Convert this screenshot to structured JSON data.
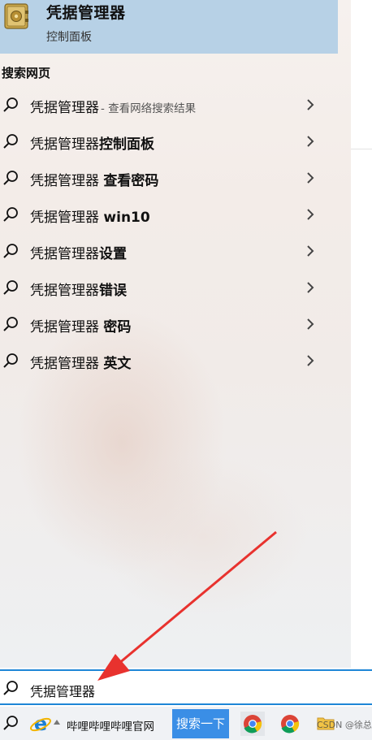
{
  "best_match": {
    "title": "凭据管理器",
    "subtitle": "控制面板",
    "icon": "credential-manager-safe-icon"
  },
  "section_heading": "搜索网页",
  "suggestions": [
    {
      "prefix": "凭据管理器",
      "suffix": "",
      "hint": "- 查看网络搜索结果"
    },
    {
      "prefix": "凭据管理器",
      "suffix": "控制面板",
      "hint": ""
    },
    {
      "prefix": "凭据管理器 ",
      "suffix": "查看密码",
      "hint": ""
    },
    {
      "prefix": "凭据管理器 ",
      "suffix": "win10",
      "hint": ""
    },
    {
      "prefix": "凭据管理器",
      "suffix": "设置",
      "hint": ""
    },
    {
      "prefix": "凭据管理器",
      "suffix": "错误",
      "hint": ""
    },
    {
      "prefix": "凭据管理器 ",
      "suffix": "密码",
      "hint": ""
    },
    {
      "prefix": "凭据管理器 ",
      "suffix": "英文",
      "hint": ""
    }
  ],
  "search": {
    "value": "凭据管理器"
  },
  "taskbar": {
    "site_label": "哔哩哔哩哔哩官网",
    "search_button": "搜索一下",
    "watermark": "CSDN @徐总"
  },
  "colors": {
    "accent": "#1e86d6",
    "best_match_bg": "#b7d1e6",
    "button_bg": "#3a8ee6",
    "annotation_arrow": "#e8322e"
  },
  "icons": [
    "search-icon",
    "chevron-right-icon",
    "ie-icon",
    "chrome-icon",
    "folder-icon"
  ]
}
